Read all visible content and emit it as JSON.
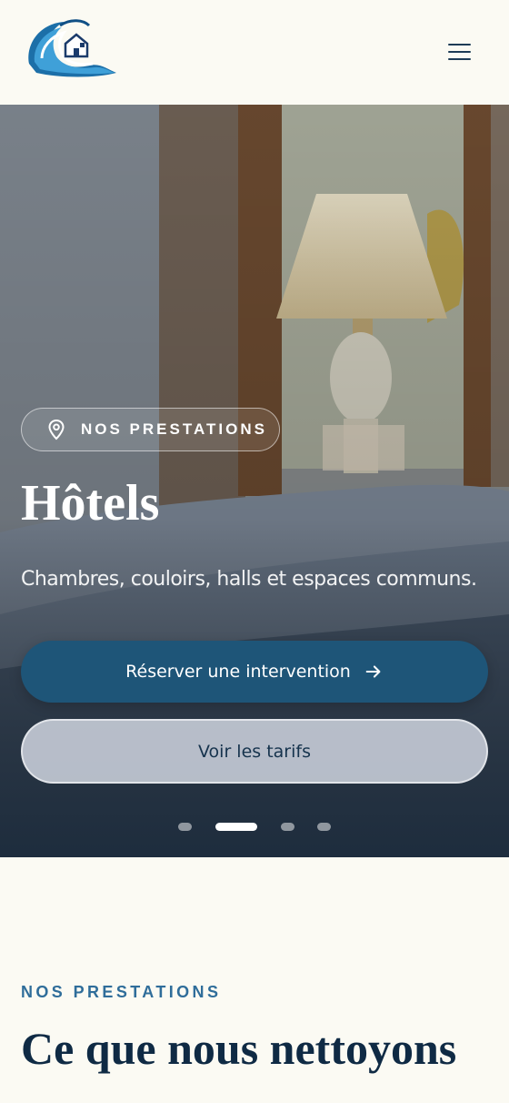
{
  "header": {
    "logo_icon": "wave-house-logo",
    "menu_icon": "hamburger-menu-icon"
  },
  "hero": {
    "badge": {
      "icon": "map-pin-icon",
      "label": "NOS PRESTATIONS"
    },
    "title": "Hôtels",
    "subtitle": "Chambres, couloirs, halls et espaces communs.",
    "primary_button": {
      "label": "Réserver une intervention",
      "icon": "arrow-right-icon"
    },
    "secondary_button": {
      "label": "Voir les tarifs"
    },
    "slides": {
      "count": 4,
      "active": 2
    }
  },
  "section": {
    "eyebrow": "NOS PRESTATIONS",
    "title": "Ce que nous nettoyons"
  },
  "colors": {
    "background": "#fbfaf3",
    "primary": "#1e5578",
    "navy": "#0f2a44",
    "accent_blue": "#2f6d9a"
  }
}
